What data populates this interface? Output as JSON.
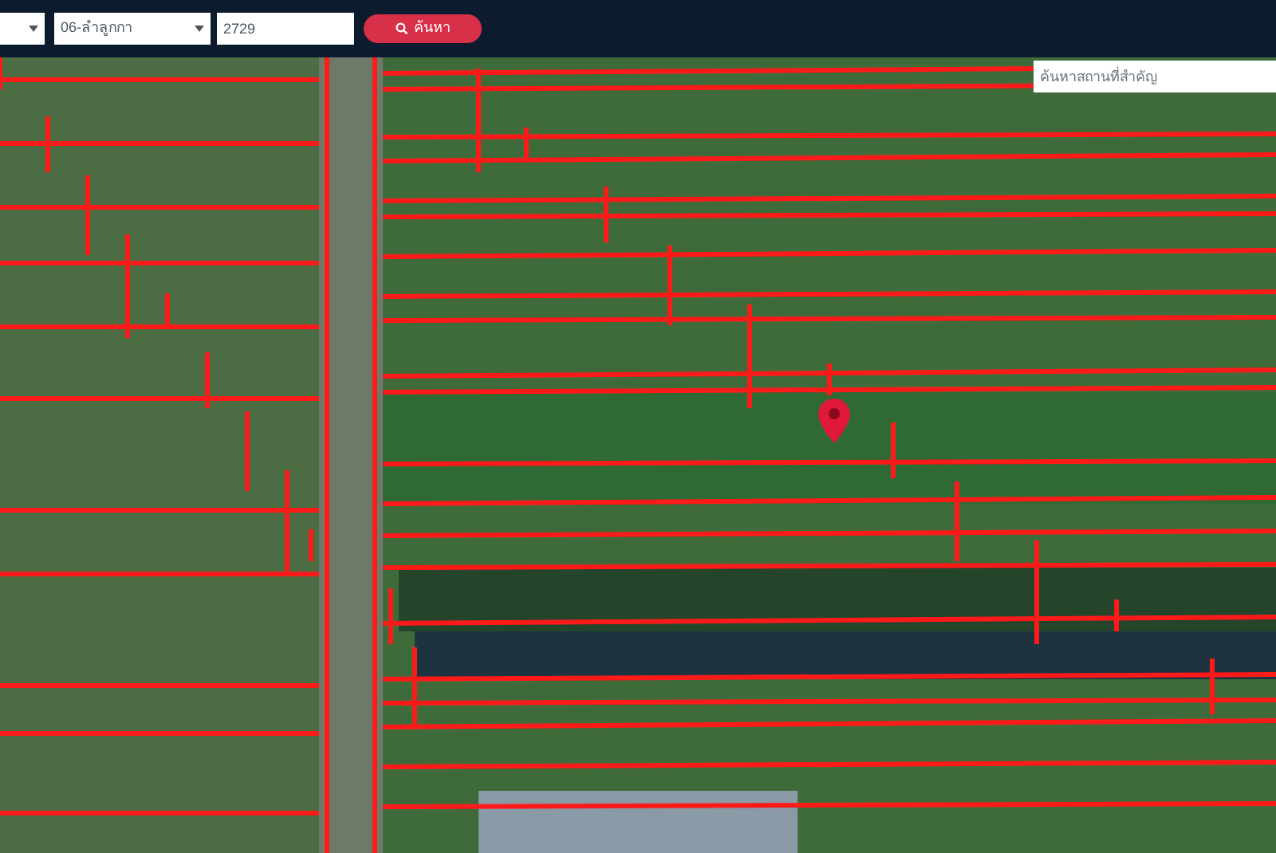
{
  "toolbar": {
    "district_select": {
      "value": "06-ลำลูกกา"
    },
    "parcel_field": {
      "value": "2729"
    },
    "search_button": {
      "label": "ค้นหา"
    }
  },
  "map": {
    "place_search": {
      "placeholder": "ค้นหาสถานที่สำคัญ"
    }
  }
}
